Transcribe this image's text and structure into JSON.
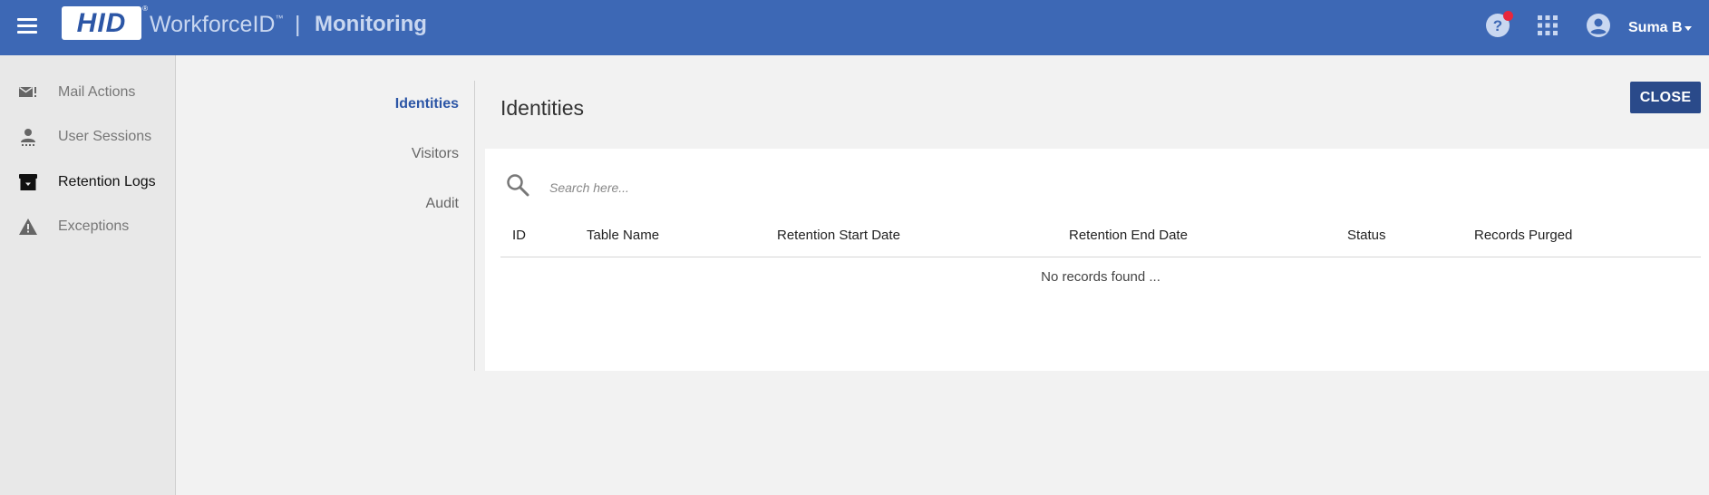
{
  "header": {
    "logo_text": "HID",
    "logo_reg": "®",
    "product_name": "WorkforceID",
    "product_tm": "™",
    "separator": "|",
    "module_name": "Monitoring",
    "user_name": "Suma B",
    "has_notification": true
  },
  "sidebar": {
    "items": [
      {
        "label": "Mail Actions",
        "icon": "mail-icon",
        "active": false
      },
      {
        "label": "User Sessions",
        "icon": "user-sessions-icon",
        "active": false
      },
      {
        "label": "Retention Logs",
        "icon": "archive-icon",
        "active": true
      },
      {
        "label": "Exceptions",
        "icon": "warning-icon",
        "active": false
      }
    ]
  },
  "tabs": [
    {
      "label": "Identities",
      "active": true
    },
    {
      "label": "Visitors",
      "active": false
    },
    {
      "label": "Audit",
      "active": false
    }
  ],
  "main": {
    "title": "Identities",
    "close_label": "CLOSE",
    "search_placeholder": "Search here...",
    "columns": [
      "ID",
      "Table Name",
      "Retention Start Date",
      "Retention End Date",
      "Status",
      "Records Purged"
    ],
    "empty_message": "No records found ..."
  },
  "colors": {
    "header_bg": "#3d68b5",
    "accent": "#2c56a6",
    "close_button": "#2a4a8a",
    "notification": "#e8273c"
  }
}
